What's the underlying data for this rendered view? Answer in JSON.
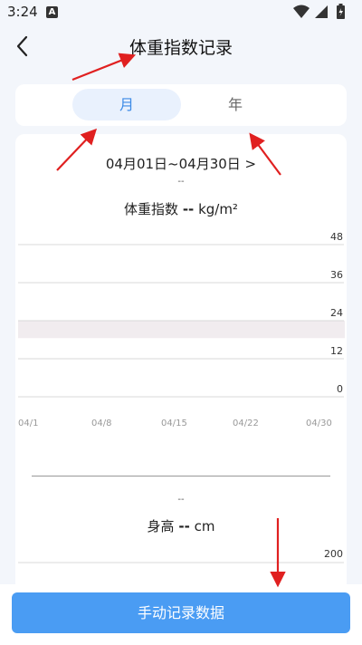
{
  "status_bar": {
    "time": "3:24",
    "notification_letter": "A"
  },
  "header": {
    "title": "体重指数记录",
    "back_icon": "chevron-left-icon"
  },
  "tabs": [
    {
      "label": "月",
      "selected": true
    },
    {
      "label": "年",
      "selected": false
    }
  ],
  "summary": {
    "date_range": "04月01日~04月30日 >",
    "bmi_dash": "--",
    "bmi_label": "体重指数",
    "bmi_value": "--",
    "bmi_unit": "kg/m²",
    "height_dash": "--",
    "height_label": "身高",
    "height_value": "--",
    "height_unit": "cm"
  },
  "chart_data": [
    {
      "type": "line",
      "x": [
        "04/1",
        "04/8",
        "04/15",
        "04/22",
        "04/30"
      ],
      "y_ticks": [
        "48",
        "36",
        "24",
        "12",
        "0"
      ],
      "ylim": [
        0,
        48
      ],
      "normal_band": [
        18.5,
        24
      ],
      "series": []
    },
    {
      "type": "line",
      "y_ticks": [
        "200"
      ],
      "series": []
    }
  ],
  "button": {
    "label": "手动记录数据"
  },
  "colors": {
    "accent": "#4a9cf3",
    "tab_selected_bg": "#e9f1fd",
    "annotation_arrow": "#e02020"
  }
}
